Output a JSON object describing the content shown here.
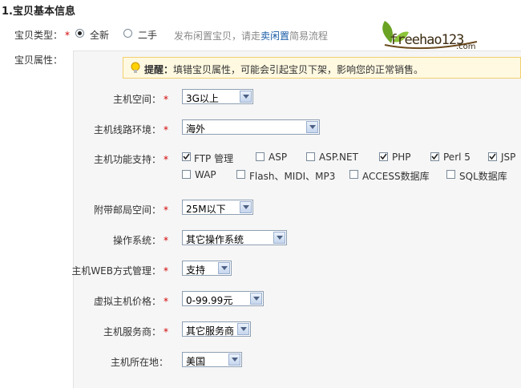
{
  "section_title": "1.宝贝基本信息",
  "item_type": {
    "label": "宝贝类型：",
    "options": [
      "全新",
      "二手"
    ],
    "selected": "全新",
    "hint_prefix": "发布闲置宝贝，请走",
    "hint_link": "卖闲置",
    "hint_suffix": "简易流程"
  },
  "logo": {
    "main": "freehao123",
    "suffix": ".com"
  },
  "attributes_label": "宝贝属性：",
  "notice": {
    "title": "提醒：",
    "text": "填错宝贝属性，可能会引起宝贝下架，影响您的正常销售。"
  },
  "fields": {
    "host_space": {
      "label": "主机空间：",
      "value": "3G以上"
    },
    "line_env": {
      "label": "主机线路环境：",
      "value": "海外"
    },
    "features": {
      "label": "主机功能支持：",
      "options": [
        {
          "label": "FTP 管理",
          "checked": true
        },
        {
          "label": "ASP",
          "checked": false
        },
        {
          "label": "ASP.NET",
          "checked": false
        },
        {
          "label": "PHP",
          "checked": true
        },
        {
          "label": "Perl 5",
          "checked": true
        },
        {
          "label": "JSP",
          "checked": true
        },
        {
          "label": "WAP",
          "checked": false
        },
        {
          "label": "Flash、MIDI、MP3",
          "checked": false
        },
        {
          "label": "ACCESS数据库",
          "checked": false
        },
        {
          "label": "SQL数据库",
          "checked": false
        }
      ]
    },
    "mail_space": {
      "label": "附带邮局空间：",
      "value": "25M以下"
    },
    "os": {
      "label": "操作系统：",
      "value": "其它操作系统"
    },
    "web_mgmt": {
      "label": "主机WEB方式管理：",
      "value": "支持"
    },
    "price": {
      "label": "虚拟主机价格：",
      "value": "0-99.99元"
    },
    "provider": {
      "label": "主机服务商：",
      "value": "其它服务商"
    },
    "location": {
      "label": "主机所在地：",
      "value": "美国"
    }
  }
}
